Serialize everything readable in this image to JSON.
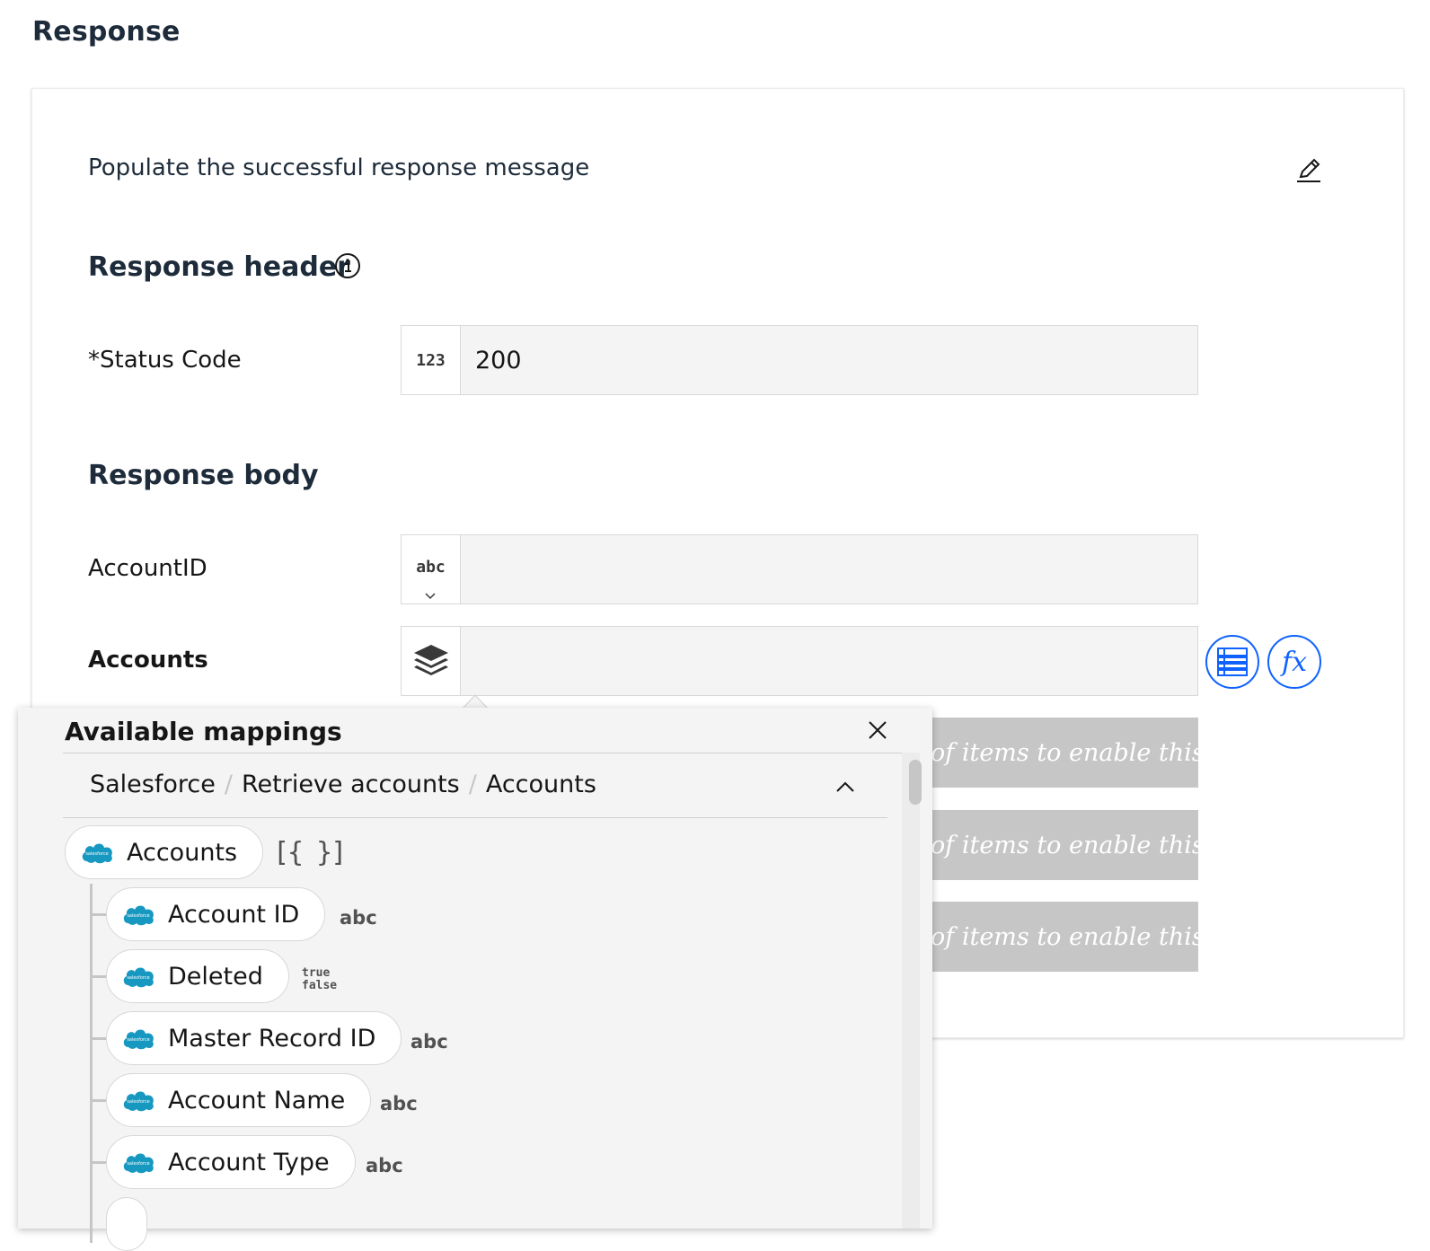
{
  "page": {
    "title": "Response"
  },
  "card": {
    "description": "Populate the successful response message",
    "response_header": {
      "title": "Response header",
      "status_code": {
        "label": "*Status Code",
        "type": "123",
        "value": "200"
      }
    },
    "response_body": {
      "title": "Response body",
      "account_id": {
        "label": "AccountID",
        "type": "abc",
        "value": ""
      },
      "accounts": {
        "label": "Accounts",
        "value": ""
      },
      "disabled_placeholder": "of items to enable this fi"
    }
  },
  "popover": {
    "title": "Available mappings",
    "breadcrumb": [
      "Salesforce",
      "Retrieve accounts",
      "Accounts"
    ],
    "root": {
      "label": "Accounts",
      "type": "[{ }]"
    },
    "items": [
      {
        "label": "Account ID",
        "type": "abc"
      },
      {
        "label": "Deleted",
        "type_true": "true",
        "type_false": "false"
      },
      {
        "label": "Master Record ID",
        "type": "abc"
      },
      {
        "label": "Account Name",
        "type": "abc"
      },
      {
        "label": "Account Type",
        "type": "abc"
      }
    ]
  },
  "colors": {
    "accent": "#0f62fe",
    "salesforce": "#1798c1",
    "disabled": "#c6c6c6"
  }
}
